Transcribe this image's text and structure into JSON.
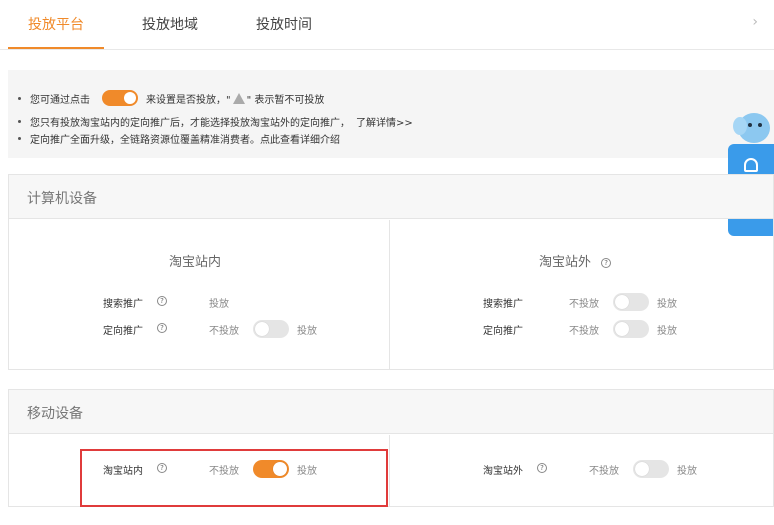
{
  "tabs": [
    {
      "label": "投放平台",
      "active": true
    },
    {
      "label": "投放地域",
      "active": false
    },
    {
      "label": "投放时间",
      "active": false
    }
  ],
  "tab_more": "›",
  "notice": {
    "line1_before": "您可通过点击",
    "line1_after": "来设置是否投放，\"",
    "line1_end": "\" 表示暂不可投放",
    "line2": "您只有投放淘宝站内的定向推广后，才能选择投放淘宝站外的定向推广，",
    "line2_link": "了解详情>>",
    "line3": "定向推广全面升级，全链路资源位覆盖精准消费者。点此查看详细介绍"
  },
  "pc_section": {
    "title": "计算机设备",
    "inside": {
      "title": "淘宝站内",
      "rows": [
        {
          "label": "搜索推广",
          "on_label": "投放"
        },
        {
          "label": "定向推广",
          "off_label": "不投放",
          "on_label": "投放",
          "enabled": false
        }
      ]
    },
    "outside": {
      "title": "淘宝站外",
      "rows": [
        {
          "label": "搜索推广",
          "off_label": "不投放",
          "on_label": "投放",
          "enabled": false
        },
        {
          "label": "定向推广",
          "off_label": "不投放",
          "on_label": "投放",
          "enabled": false
        }
      ]
    }
  },
  "mobile_section": {
    "title": "移动设备",
    "inside": {
      "label": "淘宝站内",
      "off_label": "不投放",
      "on_label": "投放",
      "enabled": true
    },
    "outside": {
      "label": "淘宝站外",
      "off_label": "不投放",
      "on_label": "投放",
      "enabled": false
    }
  },
  "colors": {
    "accent": "#f08a2a",
    "highlight": "#e03b3b",
    "float_panel": "#3a9bea"
  },
  "help_glyph": "?"
}
